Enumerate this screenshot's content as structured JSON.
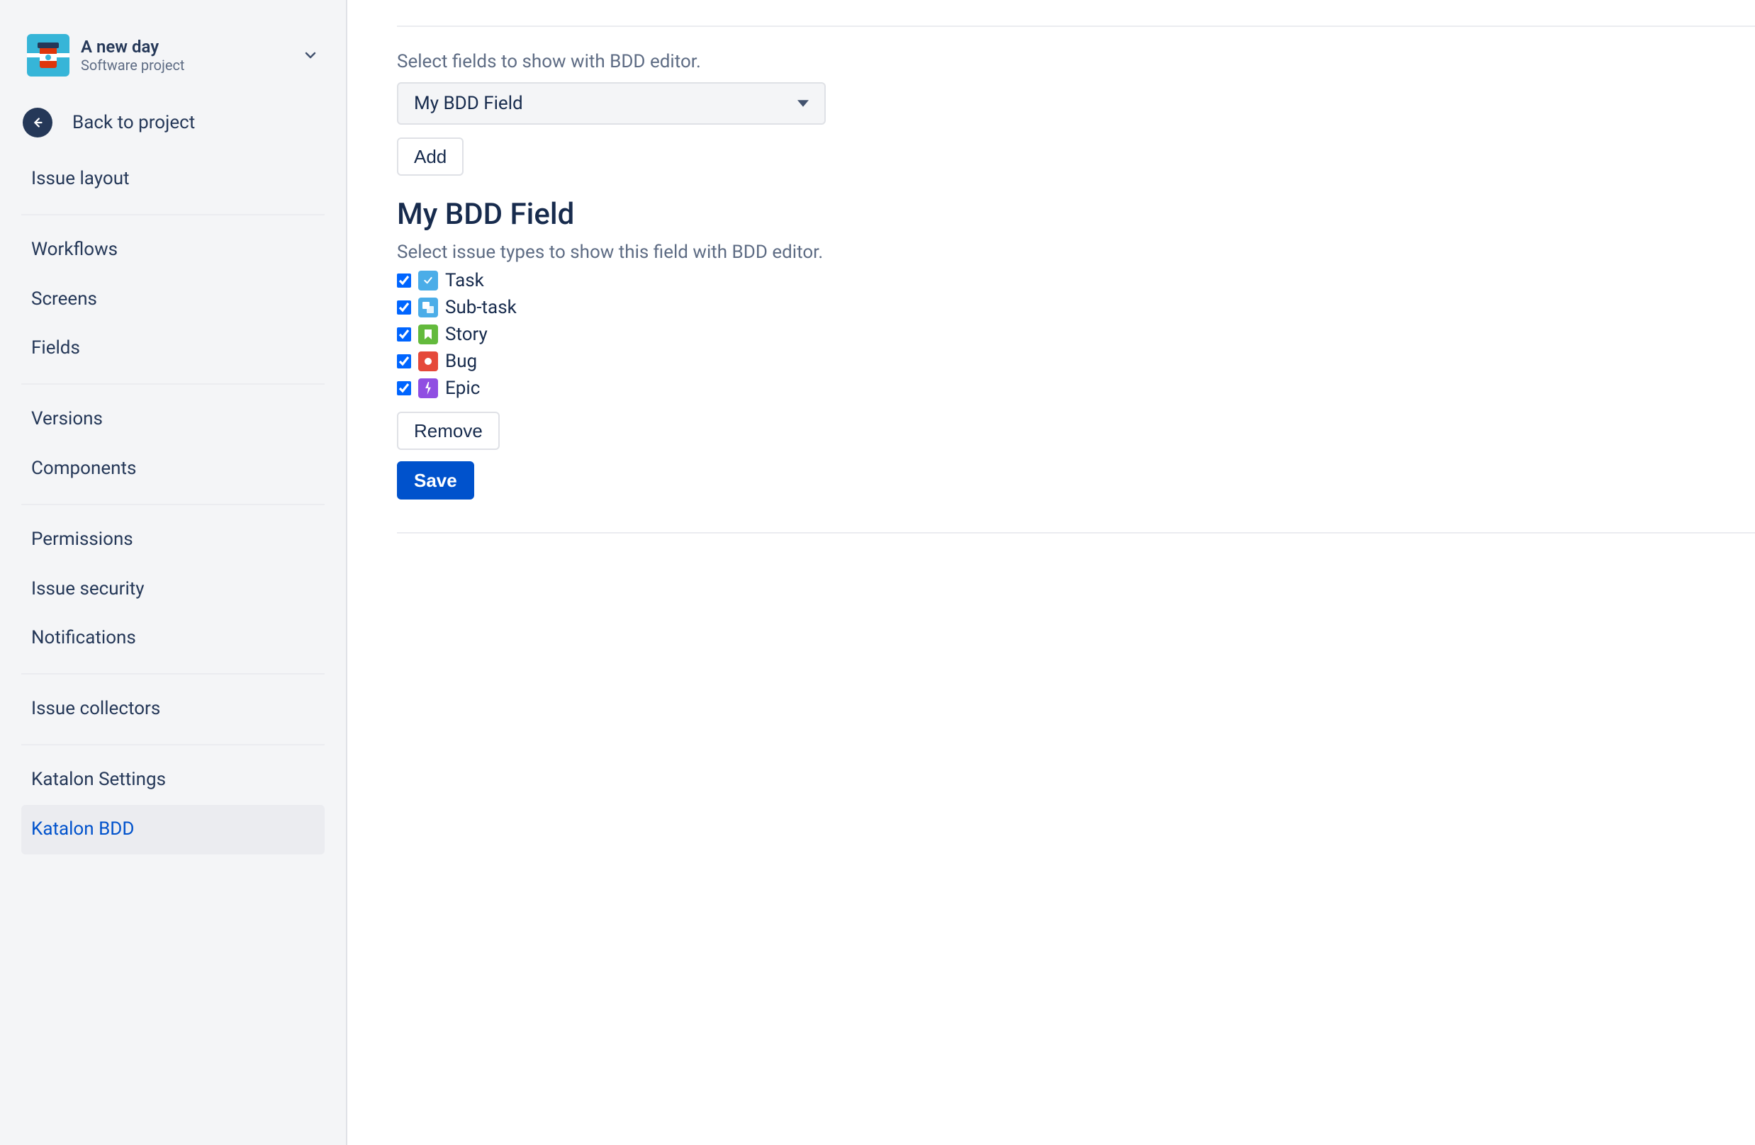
{
  "project": {
    "title": "A new day",
    "subtitle": "Software project"
  },
  "back": {
    "label": "Back to project"
  },
  "nav": {
    "group0": [
      "Issue layout"
    ],
    "group1": [
      "Workflows",
      "Screens",
      "Fields"
    ],
    "group2": [
      "Versions",
      "Components"
    ],
    "group3": [
      "Permissions",
      "Issue security",
      "Notifications"
    ],
    "group4": [
      "Issue collectors"
    ],
    "group5": [
      "Katalon Settings",
      "Katalon BDD"
    ]
  },
  "fieldSelector": {
    "label": "Select fields to show with BDD editor.",
    "selected": "My BDD Field",
    "addButton": "Add"
  },
  "fieldDetail": {
    "heading": "My BDD Field",
    "help": "Select issue types to show this field with BDD editor.",
    "issueTypes": [
      {
        "name": "Task",
        "checked": true,
        "icon": "task"
      },
      {
        "name": "Sub-task",
        "checked": true,
        "icon": "subtask"
      },
      {
        "name": "Story",
        "checked": true,
        "icon": "story"
      },
      {
        "name": "Bug",
        "checked": true,
        "icon": "bug"
      },
      {
        "name": "Epic",
        "checked": true,
        "icon": "epic"
      }
    ],
    "removeButton": "Remove",
    "saveButton": "Save"
  }
}
